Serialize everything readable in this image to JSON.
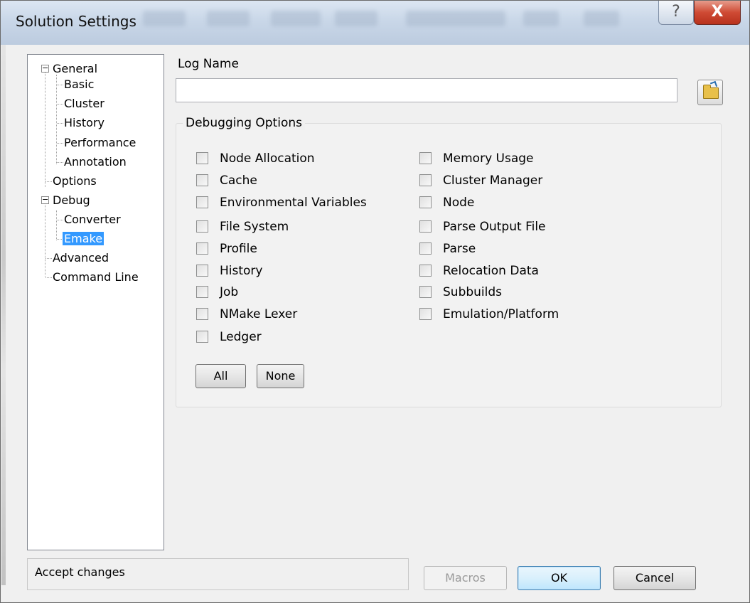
{
  "window": {
    "title": "Solution Settings",
    "help_glyph": "?",
    "close_glyph": "X"
  },
  "tree": {
    "nodes": [
      {
        "label": "General",
        "expander": "−"
      },
      {
        "label": "Basic"
      },
      {
        "label": "Cluster"
      },
      {
        "label": "History"
      },
      {
        "label": "Performance"
      },
      {
        "label": "Annotation"
      },
      {
        "label": "Options"
      },
      {
        "label": "Debug",
        "expander": "−"
      },
      {
        "label": "Converter"
      },
      {
        "label": "Emake",
        "selected": true
      },
      {
        "label": "Advanced"
      },
      {
        "label": "Command Line"
      }
    ]
  },
  "log": {
    "label": "Log Name",
    "value": ""
  },
  "debugging": {
    "title": "Debugging Options",
    "left": [
      {
        "label": "Node Allocation",
        "checked": false
      },
      {
        "label": "Cache",
        "checked": false
      },
      {
        "label": "Environmental Variables",
        "checked": false
      },
      {
        "label": "File System",
        "checked": false
      },
      {
        "label": "Profile",
        "checked": false
      },
      {
        "label": "History",
        "checked": false
      },
      {
        "label": "Job",
        "checked": false
      },
      {
        "label": "NMake Lexer",
        "checked": false
      },
      {
        "label": "Ledger",
        "checked": false
      }
    ],
    "right": [
      {
        "label": "Memory Usage",
        "checked": false
      },
      {
        "label": "Cluster Manager",
        "checked": false
      },
      {
        "label": "Node",
        "checked": false
      },
      {
        "label": "Parse Output File",
        "checked": false
      },
      {
        "label": "Parse",
        "checked": false
      },
      {
        "label": "Relocation Data",
        "checked": false
      },
      {
        "label": "Subbuilds",
        "checked": false
      },
      {
        "label": "Emulation/Platform",
        "checked": false
      }
    ],
    "all_label": "All",
    "none_label": "None"
  },
  "status": {
    "text": "Accept changes"
  },
  "buttons": {
    "macros": "Macros",
    "ok": "OK",
    "cancel": "Cancel"
  },
  "colors": {
    "selection": "#3399ff",
    "close": "#c7402a",
    "default_button_border": "#3c7fb1"
  }
}
